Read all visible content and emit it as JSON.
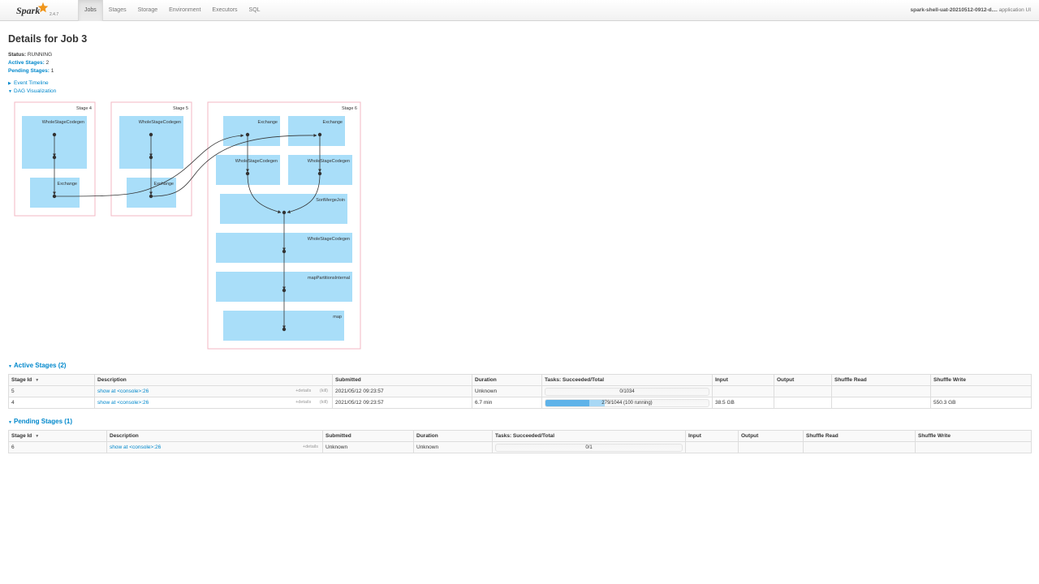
{
  "brand": {
    "name": "Spark",
    "version": "2.4.7",
    "star_color": "#f0961c"
  },
  "nav": {
    "items": [
      {
        "label": "Jobs"
      },
      {
        "label": "Stages"
      },
      {
        "label": "Storage"
      },
      {
        "label": "Environment"
      },
      {
        "label": "Executors"
      },
      {
        "label": "SQL"
      }
    ],
    "active": "Jobs",
    "app_name": "spark-shell-uat-20210512-0912-d....",
    "app_suffix": "application UI"
  },
  "page": {
    "title": "Details for Job 3",
    "status_label": "Status:",
    "status_value": "RUNNING",
    "active_stages_label": "Active Stages:",
    "active_stages_value": "2",
    "pending_stages_label": "Pending Stages:",
    "pending_stages_value": "1",
    "event_timeline": "Event Timeline",
    "dag_visualization": "DAG Visualization"
  },
  "dag": {
    "stage_border_color": "#f3b7c3",
    "node_color": "#a9def9",
    "stages": [
      {
        "label": "Stage 4",
        "nodes": [
          {
            "label": "WholeStageCodegen"
          },
          {
            "label": "Exchange"
          }
        ]
      },
      {
        "label": "Stage 5",
        "nodes": [
          {
            "label": "WholeStageCodegen"
          },
          {
            "label": "Exchange"
          }
        ]
      },
      {
        "label": "Stage 6",
        "nodes": [
          {
            "label": "Exchange"
          },
          {
            "label": "Exchange"
          },
          {
            "label": "WholeStageCodegen"
          },
          {
            "label": "WholeStageCodegen"
          },
          {
            "label": "SortMergeJoin"
          },
          {
            "label": "WholeStageCodegen"
          },
          {
            "label": "mapPartitionsInternal"
          },
          {
            "label": "map"
          }
        ]
      }
    ]
  },
  "active_stages": {
    "heading": "Active Stages (2)",
    "columns": [
      "Stage Id",
      "Description",
      "Submitted",
      "Duration",
      "Tasks: Succeeded/Total",
      "Input",
      "Output",
      "Shuffle Read",
      "Shuffle Write"
    ],
    "rows": [
      {
        "stage_id": "5",
        "description": "show at <console>:26",
        "details": "+details",
        "kill": "(kill)",
        "submitted": "2021/05/12 09:23:57",
        "duration": "Unknown",
        "tasks_text": "0/1034",
        "succeeded_fraction": 0,
        "running_fraction": 0,
        "input": "",
        "output": "",
        "shuffle_read": "",
        "shuffle_write": ""
      },
      {
        "stage_id": "4",
        "description": "show at <console>:26",
        "details": "+details",
        "kill": "(kill)",
        "submitted": "2021/05/12 09:23:57",
        "duration": "6.7 min",
        "tasks_text": "279/1044 (100 running)",
        "succeeded_fraction": 0.267,
        "running_fraction": 0.096,
        "input": "38.5 GB",
        "output": "",
        "shuffle_read": "",
        "shuffle_write": "550.3 GB"
      }
    ]
  },
  "pending_stages": {
    "heading": "Pending Stages (1)",
    "columns": [
      "Stage Id",
      "Description",
      "Submitted",
      "Duration",
      "Tasks: Succeeded/Total",
      "Input",
      "Output",
      "Shuffle Read",
      "Shuffle Write"
    ],
    "rows": [
      {
        "stage_id": "6",
        "description": "show at <console>:26",
        "details": "+details",
        "submitted": "Unknown",
        "duration": "Unknown",
        "tasks_text": "0/1",
        "succeeded_fraction": 0,
        "running_fraction": 0,
        "input": "",
        "output": "",
        "shuffle_read": "",
        "shuffle_write": ""
      }
    ]
  }
}
